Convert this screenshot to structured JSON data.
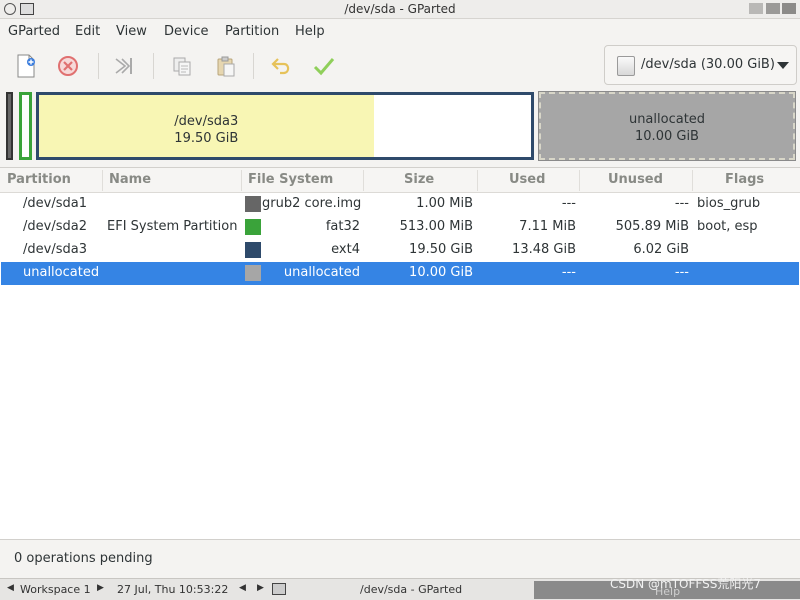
{
  "window": {
    "title": "/dev/sda - GParted"
  },
  "menu": [
    "GParted",
    "Edit",
    "View",
    "Device",
    "Partition",
    "Help"
  ],
  "toolbar": {
    "buttons": [
      {
        "name": "new",
        "icon": "new-partition-icon"
      },
      {
        "name": "delete",
        "icon": "delete-icon"
      },
      {
        "name": "resize",
        "icon": "resize-move-icon"
      },
      {
        "name": "copy",
        "icon": "copy-icon"
      },
      {
        "name": "paste",
        "icon": "paste-icon"
      },
      {
        "name": "undo",
        "icon": "undo-icon"
      },
      {
        "name": "apply",
        "icon": "apply-icon"
      }
    ],
    "device_label": "/dev/sda (30.00 GiB)"
  },
  "diskmap": {
    "sda3_label": "/dev/sda3",
    "sda3_size": "19.50 GiB",
    "sda3_used_fraction": 0.68,
    "unalloc_label": "unallocated",
    "unalloc_size": "10.00 GiB",
    "colors": {
      "sda1": "#666666",
      "sda2": "#3aa33a",
      "sda3": "#2e4a6b",
      "unallocated": "#a6a6a6",
      "used": "#f8f6b4"
    }
  },
  "table": {
    "columns": [
      "Partition",
      "Name",
      "File System",
      "Size",
      "Used",
      "Unused",
      "Flags"
    ],
    "rows": [
      {
        "partition": "/dev/sda1",
        "name": "",
        "fs": "grub2 core.img",
        "fs_color": "#666666",
        "size": "1.00 MiB",
        "used": "---",
        "unused": "---",
        "flags": "bios_grub"
      },
      {
        "partition": "/dev/sda2",
        "name": "EFI System Partition",
        "fs": "fat32",
        "fs_color": "#3aa33a",
        "size": "513.00 MiB",
        "used": "7.11 MiB",
        "unused": "505.89 MiB",
        "flags": "boot, esp"
      },
      {
        "partition": "/dev/sda3",
        "name": "",
        "fs": "ext4",
        "fs_color": "#2e4a6b",
        "size": "19.50 GiB",
        "used": "13.48 GiB",
        "unused": "6.02 GiB",
        "flags": ""
      },
      {
        "partition": "unallocated",
        "name": "",
        "fs": "unallocated",
        "fs_color": "#a6a6a6",
        "size": "10.00 GiB",
        "used": "---",
        "unused": "---",
        "flags": "",
        "selected": true
      }
    ]
  },
  "status": {
    "text": "0 operations pending"
  },
  "taskbar": {
    "workspace": "Workspace 1",
    "datetime": "27 Jul, Thu 10:53:22",
    "window_title": "/dev/sda - GParted",
    "help": "Help",
    "watermark": "CSDN @mTOFFSS荒阳光7"
  }
}
